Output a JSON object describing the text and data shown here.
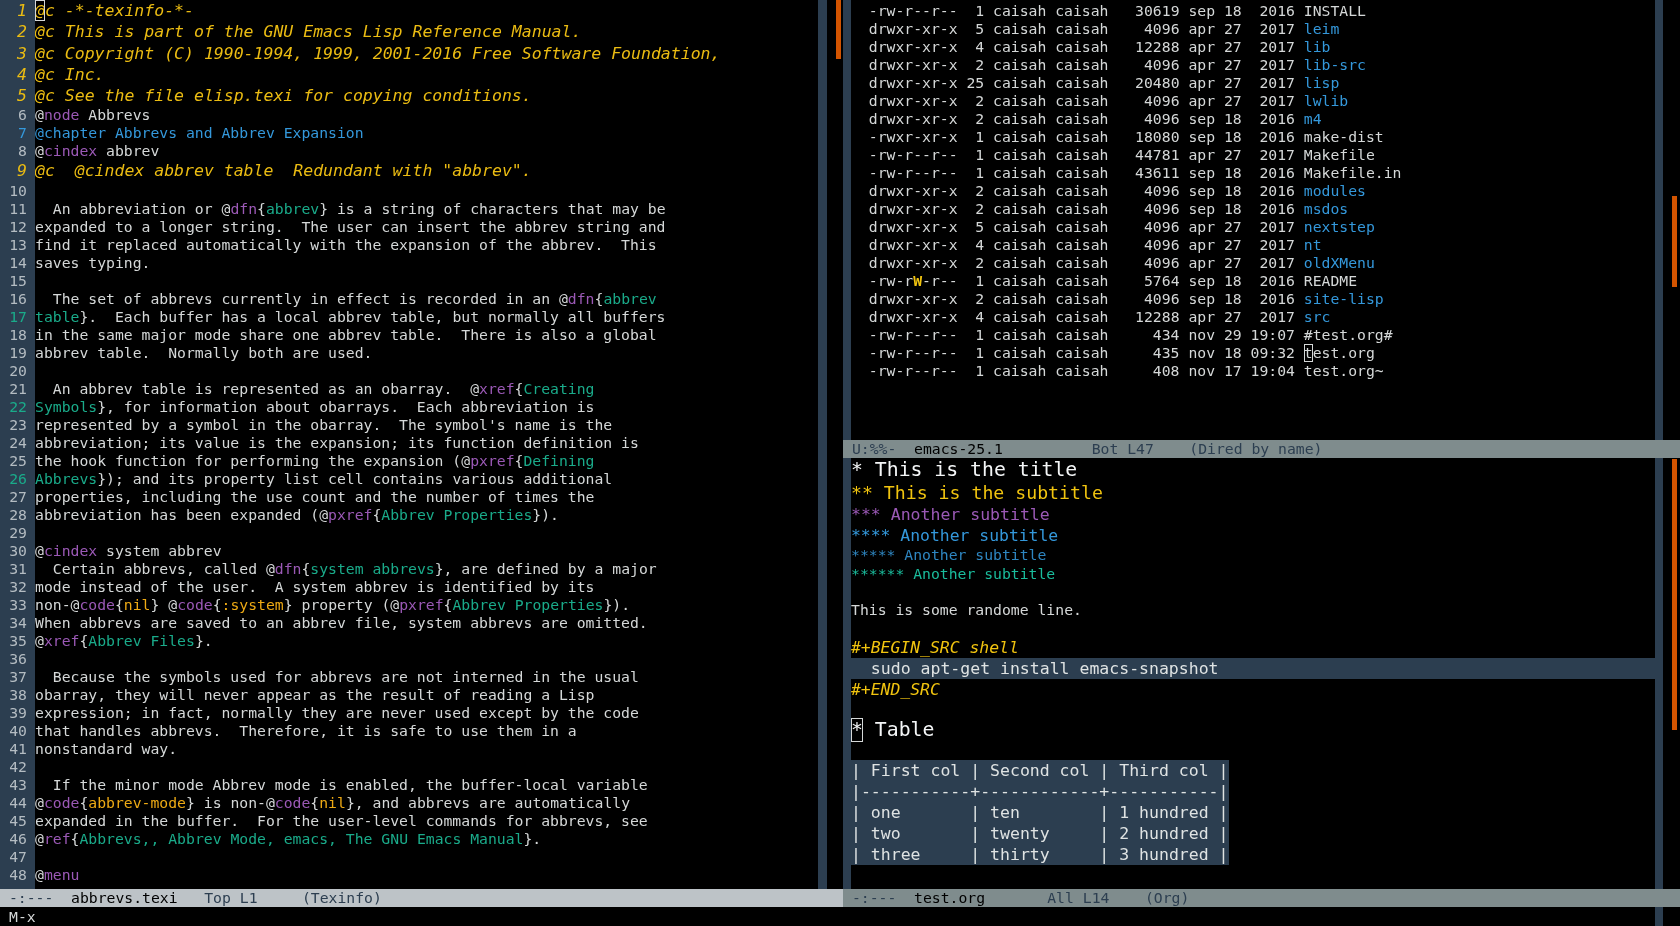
{
  "windows": [
    {
      "kind": "texinfo",
      "lines": [
        {
          "number": "1",
          "cursor": true,
          "segs": [
            {
              "text": "@c -*-texinfo-*-",
              "kind": "comment"
            }
          ]
        },
        {
          "number": "2",
          "cursor": false,
          "segs": [
            {
              "text": "@c This is part of the GNU Emacs Lisp Reference Manual.",
              "kind": "comment"
            }
          ]
        },
        {
          "number": "3",
          "cursor": false,
          "segs": [
            {
              "text": "@c Copyright (C) 1990-1994, 1999, 2001-2016 Free Software Foundation,",
              "kind": "comment"
            }
          ]
        },
        {
          "number": "4",
          "cursor": false,
          "segs": [
            {
              "text": "@c Inc.",
              "kind": "comment"
            }
          ]
        },
        {
          "number": "5",
          "cursor": false,
          "segs": [
            {
              "text": "@c See the file elisp.texi for copying conditions.",
              "kind": "comment"
            }
          ]
        },
        {
          "number": "6",
          "cursor": false,
          "segs": [
            {
              "text": "@",
              "kind": "plain"
            },
            {
              "text": "node",
              "kind": "keyword"
            },
            {
              "text": " Abbrevs",
              "kind": "plain"
            }
          ]
        },
        {
          "number": "7",
          "cursor": false,
          "segs": [
            {
              "text": "@chapter Abbrevs and Abbrev Expansion",
              "kind": "chapter"
            }
          ]
        },
        {
          "number": "8",
          "cursor": false,
          "segs": [
            {
              "text": "@",
              "kind": "plain"
            },
            {
              "text": "cindex",
              "kind": "keyword"
            },
            {
              "text": " abbrev",
              "kind": "plain"
            }
          ]
        },
        {
          "number": "9",
          "cursor": false,
          "segs": [
            {
              "text": "@c  @cindex abbrev table  Redundant with \"abbrev\".",
              "kind": "comment"
            }
          ]
        },
        {
          "number": "10",
          "cursor": false
        },
        {
          "number": "11",
          "cursor": false,
          "segs": [
            {
              "text": "  An abbreviation or @",
              "kind": "plain"
            },
            {
              "text": "dfn",
              "kind": "keyword"
            },
            {
              "text": "{",
              "kind": "plain"
            },
            {
              "text": "abbrev",
              "kind": "argument"
            },
            {
              "text": "} is a string of characters that may be",
              "kind": "plain"
            }
          ]
        },
        {
          "number": "12",
          "cursor": false,
          "segs": [
            {
              "text": "expanded to a longer string.  The user can insert the abbrev string and",
              "kind": "plain"
            }
          ]
        },
        {
          "number": "13",
          "cursor": false,
          "segs": [
            {
              "text": "find it replaced automatically with the expansion of the abbrev.  This",
              "kind": "plain"
            }
          ]
        },
        {
          "number": "14",
          "cursor": false,
          "segs": [
            {
              "text": "saves typing.",
              "kind": "plain"
            }
          ]
        },
        {
          "number": "15",
          "cursor": false
        },
        {
          "number": "16",
          "cursor": false,
          "segs": [
            {
              "text": "  The set of abbrevs currently in effect is recorded in an @",
              "kind": "plain"
            },
            {
              "text": "dfn",
              "kind": "keyword"
            },
            {
              "text": "{",
              "kind": "plain"
            },
            {
              "text": "abbrev",
              "kind": "argument"
            }
          ]
        },
        {
          "number": "17",
          "cursor": false,
          "segs": [
            {
              "text": "table",
              "kind": "argument"
            },
            {
              "text": "}.  Each buffer has a local abbrev table, but normally all buffers",
              "kind": "plain"
            }
          ]
        },
        {
          "number": "18",
          "cursor": false,
          "segs": [
            {
              "text": "in the same major mode share one abbrev table.  There is also a global",
              "kind": "plain"
            }
          ]
        },
        {
          "number": "19",
          "cursor": false,
          "segs": [
            {
              "text": "abbrev table.  Normally both are used.",
              "kind": "plain"
            }
          ]
        },
        {
          "number": "20",
          "cursor": false
        },
        {
          "number": "21",
          "cursor": false,
          "segs": [
            {
              "text": "  An abbrev table is represented as an obarray.  @",
              "kind": "plain"
            },
            {
              "text": "xref",
              "kind": "keyword"
            },
            {
              "text": "{",
              "kind": "plain"
            },
            {
              "text": "Creating",
              "kind": "argument"
            }
          ]
        },
        {
          "number": "22",
          "cursor": false,
          "segs": [
            {
              "text": "Symbols",
              "kind": "argument"
            },
            {
              "text": "}, for information about obarrays.  Each abbreviation is",
              "kind": "plain"
            }
          ]
        },
        {
          "number": "23",
          "cursor": false,
          "segs": [
            {
              "text": "represented by a symbol in the obarray.  The symbol's name is the",
              "kind": "plain"
            }
          ]
        },
        {
          "number": "24",
          "cursor": false,
          "segs": [
            {
              "text": "abbreviation; its value is the expansion; its function definition is",
              "kind": "plain"
            }
          ]
        },
        {
          "number": "25",
          "cursor": false,
          "segs": [
            {
              "text": "the hook function for performing the expansion (@",
              "kind": "plain"
            },
            {
              "text": "pxref",
              "kind": "keyword"
            },
            {
              "text": "{",
              "kind": "plain"
            },
            {
              "text": "Defining",
              "kind": "argument"
            }
          ]
        },
        {
          "number": "26",
          "cursor": false,
          "segs": [
            {
              "text": "Abbrevs",
              "kind": "argument"
            },
            {
              "text": "}); and its property list cell contains various additional",
              "kind": "plain"
            }
          ]
        },
        {
          "number": "27",
          "cursor": false,
          "segs": [
            {
              "text": "properties, including the use count and the number of times the",
              "kind": "plain"
            }
          ]
        },
        {
          "number": "28",
          "cursor": false,
          "segs": [
            {
              "text": "abbreviation has been expanded (@",
              "kind": "plain"
            },
            {
              "text": "pxref",
              "kind": "keyword"
            },
            {
              "text": "{",
              "kind": "plain"
            },
            {
              "text": "Abbrev Properties",
              "kind": "argument"
            },
            {
              "text": "}).",
              "kind": "plain"
            }
          ]
        },
        {
          "number": "29",
          "cursor": false
        },
        {
          "number": "30",
          "cursor": false,
          "segs": [
            {
              "text": "@",
              "kind": "plain"
            },
            {
              "text": "cindex",
              "kind": "keyword"
            },
            {
              "text": " system abbrev",
              "kind": "plain"
            }
          ]
        },
        {
          "number": "31",
          "cursor": false,
          "segs": [
            {
              "text": "  Certain abbrevs, called @",
              "kind": "plain"
            },
            {
              "text": "dfn",
              "kind": "keyword"
            },
            {
              "text": "{",
              "kind": "plain"
            },
            {
              "text": "system abbrevs",
              "kind": "argument"
            },
            {
              "text": "}, are defined by a major",
              "kind": "plain"
            }
          ]
        },
        {
          "number": "32",
          "cursor": false,
          "segs": [
            {
              "text": "mode instead of the user.  A system abbrev is identified by its",
              "kind": "plain"
            }
          ]
        },
        {
          "number": "33",
          "cursor": false,
          "segs": [
            {
              "text": "non-@",
              "kind": "plain"
            },
            {
              "text": "code",
              "kind": "keyword"
            },
            {
              "text": "{",
              "kind": "plain"
            },
            {
              "text": "nil",
              "kind": "code"
            },
            {
              "text": "} @",
              "kind": "plain"
            },
            {
              "text": "code",
              "kind": "keyword"
            },
            {
              "text": "{",
              "kind": "plain"
            },
            {
              "text": ":system",
              "kind": "code"
            },
            {
              "text": "} property (@",
              "kind": "plain"
            },
            {
              "text": "pxref",
              "kind": "keyword"
            },
            {
              "text": "{",
              "kind": "plain"
            },
            {
              "text": "Abbrev Properties",
              "kind": "argument"
            },
            {
              "text": "}).",
              "kind": "plain"
            }
          ]
        },
        {
          "number": "34",
          "cursor": false,
          "segs": [
            {
              "text": "When abbrevs are saved to an abbrev file, system abbrevs are omitted.",
              "kind": "plain"
            }
          ]
        },
        {
          "number": "35",
          "cursor": false,
          "segs": [
            {
              "text": "@",
              "kind": "plain"
            },
            {
              "text": "xref",
              "kind": "keyword"
            },
            {
              "text": "{",
              "kind": "plain"
            },
            {
              "text": "Abbrev Files",
              "kind": "argument"
            },
            {
              "text": "}.",
              "kind": "plain"
            }
          ]
        },
        {
          "number": "36",
          "cursor": false
        },
        {
          "number": "37",
          "cursor": false,
          "segs": [
            {
              "text": "  Because the symbols used for abbrevs are not interned in the usual",
              "kind": "plain"
            }
          ]
        },
        {
          "number": "38",
          "cursor": false,
          "segs": [
            {
              "text": "obarray, they will never appear as the result of reading a Lisp",
              "kind": "plain"
            }
          ]
        },
        {
          "number": "39",
          "cursor": false,
          "segs": [
            {
              "text": "expression; in fact, normally they are never used except by the code",
              "kind": "plain"
            }
          ]
        },
        {
          "number": "40",
          "cursor": false,
          "segs": [
            {
              "text": "that handles abbrevs.  Therefore, it is safe to use them in a",
              "kind": "plain"
            }
          ]
        },
        {
          "number": "41",
          "cursor": false,
          "segs": [
            {
              "text": "nonstandard way.",
              "kind": "plain"
            }
          ]
        },
        {
          "number": "42",
          "cursor": false
        },
        {
          "number": "43",
          "cursor": false,
          "segs": [
            {
              "text": "  If the minor mode Abbrev mode is enabled, the buffer-local variable",
              "kind": "plain"
            }
          ]
        },
        {
          "number": "44",
          "cursor": false,
          "segs": [
            {
              "text": "@",
              "kind": "plain"
            },
            {
              "text": "code",
              "kind": "keyword"
            },
            {
              "text": "{",
              "kind": "plain"
            },
            {
              "text": "abbrev-mode",
              "kind": "code"
            },
            {
              "text": "} is non-@",
              "kind": "plain"
            },
            {
              "text": "code",
              "kind": "keyword"
            },
            {
              "text": "{",
              "kind": "plain"
            },
            {
              "text": "nil",
              "kind": "code"
            },
            {
              "text": "}, and abbrevs are automatically",
              "kind": "plain"
            }
          ]
        },
        {
          "number": "45",
          "cursor": false,
          "segs": [
            {
              "text": "expanded in the buffer.  For the user-level commands for abbrevs, see",
              "kind": "plain"
            }
          ]
        },
        {
          "number": "46",
          "cursor": false,
          "segs": [
            {
              "text": "@",
              "kind": "plain"
            },
            {
              "text": "ref",
              "kind": "keyword"
            },
            {
              "text": "{",
              "kind": "plain"
            },
            {
              "text": "Abbrevs,, Abbrev Mode, emacs, The GNU Emacs Manual",
              "kind": "argument"
            },
            {
              "text": "}.",
              "kind": "plain"
            }
          ]
        },
        {
          "number": "47",
          "cursor": false
        },
        {
          "number": "48",
          "cursor": false,
          "segs": [
            {
              "text": "@",
              "kind": "plain"
            },
            {
              "text": "menu",
              "kind": "keyword"
            }
          ]
        }
      ],
      "mode_line": {
        "active": true,
        "status": "-:---",
        "buffer": "abbrevs.texi",
        "position": "Top L1",
        "mode": "(Texinfo)"
      }
    },
    {
      "kind": "dired",
      "rows": [
        {
          "perms": "-rw-r--r--",
          "links": "1",
          "owner": "caisah",
          "group": "caisah",
          "size": "30619",
          "month": "sep",
          "day": "18",
          "time": "2016",
          "name": "INSTALL",
          "kind": "file",
          "cursor": false
        },
        {
          "perms": "drwxr-xr-x",
          "links": "5",
          "owner": "caisah",
          "group": "caisah",
          "size": "4096",
          "month": "apr",
          "day": "27",
          "time": "2017",
          "name": "leim",
          "kind": "directory",
          "cursor": false
        },
        {
          "perms": "drwxr-xr-x",
          "links": "4",
          "owner": "caisah",
          "group": "caisah",
          "size": "12288",
          "month": "apr",
          "day": "27",
          "time": "2017",
          "name": "lib",
          "kind": "directory",
          "cursor": false
        },
        {
          "perms": "drwxr-xr-x",
          "links": "2",
          "owner": "caisah",
          "group": "caisah",
          "size": "4096",
          "month": "apr",
          "day": "27",
          "time": "2017",
          "name": "lib-src",
          "kind": "directory",
          "cursor": false
        },
        {
          "perms": "drwxr-xr-x",
          "links": "25",
          "owner": "caisah",
          "group": "caisah",
          "size": "20480",
          "month": "apr",
          "day": "27",
          "time": "2017",
          "name": "lisp",
          "kind": "directory",
          "cursor": false
        },
        {
          "perms": "drwxr-xr-x",
          "links": "2",
          "owner": "caisah",
          "group": "caisah",
          "size": "4096",
          "month": "apr",
          "day": "27",
          "time": "2017",
          "name": "lwlib",
          "kind": "directory",
          "cursor": false
        },
        {
          "perms": "drwxr-xr-x",
          "links": "2",
          "owner": "caisah",
          "group": "caisah",
          "size": "4096",
          "month": "sep",
          "day": "18",
          "time": "2016",
          "name": "m4",
          "kind": "directory",
          "cursor": false
        },
        {
          "perms": "-rwxr-xr-x",
          "links": "1",
          "owner": "caisah",
          "group": "caisah",
          "size": "18080",
          "month": "sep",
          "day": "18",
          "time": "2016",
          "name": "make-dist",
          "kind": "file",
          "cursor": false
        },
        {
          "perms": "-rw-r--r--",
          "links": "1",
          "owner": "caisah",
          "group": "caisah",
          "size": "44781",
          "month": "apr",
          "day": "27",
          "time": "2017",
          "name": "Makefile",
          "kind": "file",
          "cursor": false
        },
        {
          "perms": "-rw-r--r--",
          "links": "1",
          "owner": "caisah",
          "group": "caisah",
          "size": "43611",
          "month": "sep",
          "day": "18",
          "time": "2016",
          "name": "Makefile.in",
          "kind": "file",
          "cursor": false
        },
        {
          "perms": "drwxr-xr-x",
          "links": "2",
          "owner": "caisah",
          "group": "caisah",
          "size": "4096",
          "month": "sep",
          "day": "18",
          "time": "2016",
          "name": "modules",
          "kind": "directory",
          "cursor": false
        },
        {
          "perms": "drwxr-xr-x",
          "links": "2",
          "owner": "caisah",
          "group": "caisah",
          "size": "4096",
          "month": "sep",
          "day": "18",
          "time": "2016",
          "name": "msdos",
          "kind": "directory",
          "cursor": false
        },
        {
          "perms": "drwxr-xr-x",
          "links": "5",
          "owner": "caisah",
          "group": "caisah",
          "size": "4096",
          "month": "apr",
          "day": "27",
          "time": "2017",
          "name": "nextstep",
          "kind": "directory",
          "cursor": false
        },
        {
          "perms": "drwxr-xr-x",
          "links": "4",
          "owner": "caisah",
          "group": "caisah",
          "size": "4096",
          "month": "apr",
          "day": "27",
          "time": "2017",
          "name": "nt",
          "kind": "directory",
          "cursor": false
        },
        {
          "perms": "drwxr-xr-x",
          "links": "2",
          "owner": "caisah",
          "group": "caisah",
          "size": "4096",
          "month": "apr",
          "day": "27",
          "time": "2017",
          "name": "oldXMenu",
          "kind": "directory",
          "cursor": false
        },
        {
          "perms": "-rw-r**W**-r--",
          "links": "1",
          "owner": "caisah",
          "group": "caisah",
          "size": "5764",
          "month": "sep",
          "day": "18",
          "time": "2016",
          "name": "README",
          "kind": "file",
          "cursor": false
        },
        {
          "perms": "drwxr-xr-x",
          "links": "2",
          "owner": "caisah",
          "group": "caisah",
          "size": "4096",
          "month": "sep",
          "day": "18",
          "time": "2016",
          "name": "site-lisp",
          "kind": "directory",
          "cursor": false
        },
        {
          "perms": "drwxr-xr-x",
          "links": "4",
          "owner": "caisah",
          "group": "caisah",
          "size": "12288",
          "month": "apr",
          "day": "27",
          "time": "2017",
          "name": "src",
          "kind": "directory",
          "cursor": false
        },
        {
          "perms": "-rw-r--r--",
          "links": "1",
          "owner": "caisah",
          "group": "caisah",
          "size": "434",
          "month": "nov",
          "day": "29",
          "time": "19:07",
          "name": "#test.org#",
          "kind": "file",
          "cursor": false
        },
        {
          "perms": "-rw-r--r--",
          "links": "1",
          "owner": "caisah",
          "group": "caisah",
          "size": "435",
          "month": "nov",
          "day": "18",
          "time": "09:32",
          "name": "test.org",
          "kind": "file",
          "cursor": true
        },
        {
          "perms": "-rw-r--r--",
          "links": "1",
          "owner": "caisah",
          "group": "caisah",
          "size": "408",
          "month": "nov",
          "day": "17",
          "time": "19:04",
          "name": "test.org~",
          "kind": "file",
          "cursor": false
        }
      ],
      "mode_line": {
        "active": false,
        "status": "U:%%-",
        "buffer": "emacs-25.1",
        "position": "Bot L47",
        "mode": "(Dired by name)"
      }
    },
    {
      "kind": "org",
      "items": [
        {
          "kind": "heading",
          "text": "* This is the title",
          "cursor": false,
          "children": [
            {
              "kind": "heading",
              "text": "** This is the subtitle",
              "cursor": false,
              "children": [
                {
                  "kind": "heading",
                  "text": "*** Another subtitle",
                  "cursor": false,
                  "children": [
                    {
                      "kind": "heading",
                      "text": "**** Another subtitle",
                      "cursor": false,
                      "children": [
                        {
                          "kind": "heading",
                          "text": "***** Another subtitle",
                          "cursor": false,
                          "children": [
                            {
                              "kind": "heading",
                              "text": "****** Another subtitle",
                              "cursor": false,
                              "children": [
                                {
                                  "kind": "paragraph",
                                  "text": "This is some randome line.",
                                  "cursor": false
                                },
                                {
                                  "kind": "src",
                                  "begin": "#+BEGIN_SRC shell",
                                  "body": "sudo apt-get install emacs-snapshot",
                                  "end": "#+END_SRC",
                                  "cursor": false
                                }
                              ]
                            }
                          ]
                        }
                      ]
                    }
                  ]
                }
              ]
            }
          ]
        },
        {
          "kind": "heading",
          "text": "* Table",
          "cursor": true,
          "children": [
            {
              "kind": "table",
              "cursor": false,
              "lines": [
                "| First col | Second col | Third col |",
                "|-----------+------------+-----------|",
                "| one       | ten        | 1 hundred |",
                "| two       | twenty     | 2 hundred |",
                "| three     | thirty     | 3 hundred |"
              ]
            }
          ]
        }
      ],
      "mode_line": {
        "active": false,
        "status": "-:---",
        "buffer": "test.org",
        "position": "All L14",
        "mode": "(Org)"
      }
    }
  ],
  "minibuffer": {
    "text": "M-x"
  }
}
